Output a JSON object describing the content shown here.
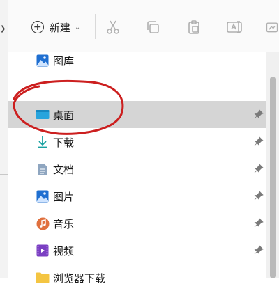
{
  "toolbar": {
    "new_label": "新建",
    "icons": [
      "cut-icon",
      "copy-icon",
      "paste-icon",
      "rename-icon",
      "share-icon"
    ]
  },
  "nav": {
    "gallery": {
      "label": "图库",
      "icon": "gallery-icon"
    },
    "items": [
      {
        "label": "桌面",
        "icon": "desktop-icon",
        "selected": true,
        "pinned": true
      },
      {
        "label": "下载",
        "icon": "download-icon",
        "pinned": true
      },
      {
        "label": "文档",
        "icon": "documents-icon",
        "pinned": true
      },
      {
        "label": "图片",
        "icon": "pictures-icon",
        "pinned": true
      },
      {
        "label": "音乐",
        "icon": "music-icon",
        "pinned": true
      },
      {
        "label": "视频",
        "icon": "videos-icon",
        "pinned": true
      },
      {
        "label": "浏览器下载",
        "icon": "folder-icon",
        "pinned": false
      }
    ]
  },
  "colors": {
    "selected_bg": "#d5d5d5",
    "annotation": "#cc1f1f",
    "accent": "#1a73e8"
  }
}
